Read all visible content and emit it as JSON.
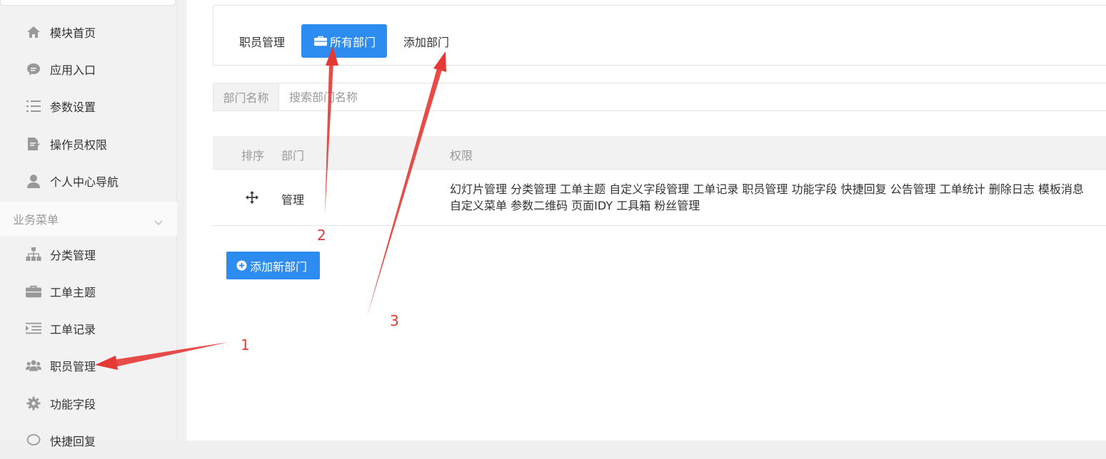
{
  "sidebar": {
    "items_top": [
      {
        "label": "模块首页",
        "icon": "home-icon"
      },
      {
        "label": "应用入口",
        "icon": "chat-bubble-icon"
      },
      {
        "label": "参数设置",
        "icon": "list-icon"
      },
      {
        "label": "操作员权限",
        "icon": "document-edit-icon"
      },
      {
        "label": "个人中心导航",
        "icon": "user-icon"
      }
    ],
    "group_label": "业务菜单",
    "items_group": [
      {
        "label": "分类管理",
        "icon": "sitemap-icon"
      },
      {
        "label": "工单主题",
        "icon": "briefcase-icon"
      },
      {
        "label": "工单记录",
        "icon": "indent-list-icon"
      },
      {
        "label": "职员管理",
        "icon": "users-icon"
      },
      {
        "label": "功能字段",
        "icon": "gear-icon"
      },
      {
        "label": "快捷回复",
        "icon": "comment-icon"
      }
    ]
  },
  "tabs": {
    "staff": "职员管理",
    "all_departments": "所有部门",
    "add_department": "添加部门"
  },
  "search": {
    "label": "部门名称",
    "placeholder": "搜索部门名称"
  },
  "table": {
    "headers": [
      "排序",
      "部门",
      "权限"
    ],
    "rows": [
      {
        "department": "管理",
        "permissions": "幻灯片管理 分类管理 工单主题 自定义字段管理 工单记录 职员管理 功能字段 快捷回复 公告管理 工单统计 删除日志 模板消息 自定义菜单 参数二维码 页面IDY 工具箱 粉丝管理"
      }
    ]
  },
  "add_button": "添加新部门",
  "annotations": [
    "1",
    "2",
    "3"
  ],
  "colors": {
    "accent": "#2d8cf0",
    "annotation": "#e53935"
  }
}
